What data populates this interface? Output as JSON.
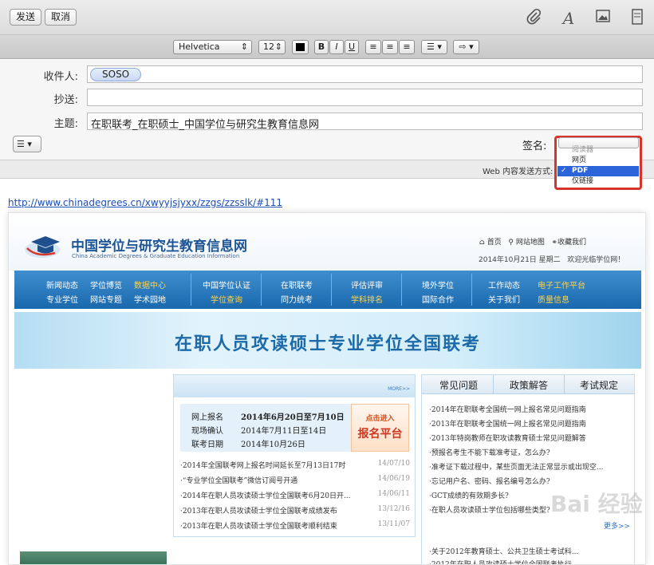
{
  "toolbar": {
    "send": "发送",
    "cancel": "取消",
    "icons": [
      "paperclip-icon",
      "font-icon",
      "photo-icon",
      "stationery-icon"
    ]
  },
  "format": {
    "font": "Helvetica",
    "size": "12",
    "bold": "B",
    "italic": "I",
    "underline": "U",
    "list": "☰",
    "indent": "⇨"
  },
  "compose": {
    "to_label": "收件人:",
    "to_value": "SOSO",
    "cc_label": "抄送:",
    "subject_label": "主题:",
    "subject_value": "在职联考_在职硕士_中国学位与研究生教育信息网",
    "signature_label": "签名:",
    "web_send_label": "Web 内容发送方式:"
  },
  "dropdown": {
    "options": [
      {
        "label": "阅读器",
        "state": "disabled"
      },
      {
        "label": "网页",
        "state": "normal"
      },
      {
        "label": "PDF",
        "state": "selected"
      },
      {
        "label": "仅链接",
        "state": "normal"
      }
    ]
  },
  "url": "http://www.chinadegrees.cn/xwyyjsjyxx/zzgs/zzsslk/#111",
  "site": {
    "logo_cn": "中国学位与研究生教育信息网",
    "logo_en": "China Academic Degrees & Graduate Education Information",
    "top_links": [
      "首页",
      "网站地图",
      "收藏我们"
    ],
    "date": "2014年10月21日 星期二   欢迎光临学位网！",
    "nav": [
      [
        "新闻动态",
        "学位博览",
        "数据中心"
      ],
      [
        "专业学位",
        "网站专题",
        "学术园地"
      ],
      [
        "中国学位认证",
        "学位查询"
      ],
      [
        "在职联考",
        "同力统考"
      ],
      [
        "评估评审",
        "学科排名"
      ],
      [
        "境外学位",
        "国际合作"
      ],
      [
        "工作动态",
        "电子工作平台"
      ],
      [
        "关于我们",
        "质量信息"
      ]
    ],
    "banner": "在职人员攻读硕士专业学位全国联考",
    "more1": "MORE>>",
    "reg": [
      {
        "k": "网上报名",
        "v": "2014年6月20日至7月10日"
      },
      {
        "k": "现场确认",
        "v": "2014年7月11日至14日"
      },
      {
        "k": "联考日期",
        "v": "2014年10月26日"
      }
    ],
    "reg_btn1": "点击进入",
    "reg_btn2": "报名平台",
    "news": [
      {
        "t": "·2014年全国联考网上报名时间延长至7月13日17时",
        "d": "14/07/10"
      },
      {
        "t": "·“专业学位全国联考”微信订阅号开通",
        "d": "14/06/19"
      },
      {
        "t": "·2014年在职人员攻读硕士学位全国联考6月20日开...",
        "d": "14/06/11"
      },
      {
        "t": "·2013年在职人员攻读硕士学位全国联考成绩发布",
        "d": "13/12/16"
      },
      {
        "t": "·2013年在职人员攻读硕士学位全国联考顺利结束",
        "d": "13/11/07"
      }
    ],
    "tabs": [
      "常见问题",
      "政策解答",
      "考试规定"
    ],
    "faq": [
      "·2014年在职联考全国统一网上报名常见问题指南",
      "·2013年在职联考全国统一网上报名常见问题指南",
      "·2013年特岗教师在职攻读教育硕士常见问题解答",
      "·预报名考生不能下载准考证，怎么办?",
      "·准考证下载过程中，某些页面无法正常显示或出现空...",
      "·忘记用户名、密码、报名编号怎么办?",
      "·GCT成绩的有效期多长?",
      "·在职人员攻读硕士学位包括哪些类型?"
    ],
    "more2": "更多>>",
    "faq2": [
      "·关于2012年教育硕士、公共卫生硕士考试科...",
      "·2012年在职人员攻读硕士学位全国联考执行..."
    ]
  },
  "watermark": "Bai 经验"
}
